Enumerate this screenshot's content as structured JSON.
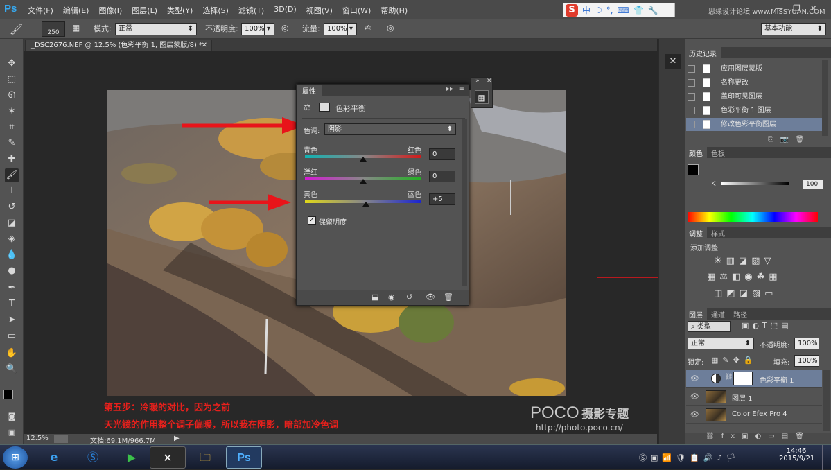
{
  "app": {
    "logo": "Ps"
  },
  "menu": [
    "文件(F)",
    "编辑(E)",
    "图像(I)",
    "图层(L)",
    "类型(Y)",
    "选择(S)",
    "滤镜(T)",
    "3D(D)",
    "视图(V)",
    "窗口(W)",
    "帮助(H)"
  ],
  "ime": {
    "label": "中"
  },
  "watermark": "思缘设计论坛 www.MISSYUAN.COM",
  "options": {
    "brush_size": "250",
    "mode_label": "模式:",
    "mode_value": "正常",
    "opacity_label": "不透明度:",
    "opacity_value": "100%",
    "flow_label": "流量:",
    "flow_value": "100%",
    "workspace": "基本功能"
  },
  "document": {
    "tab_title": "_DSC2676.NEF @ 12.5% (色彩平衡 1, 图层蒙版/8) *",
    "zoom": "12.5%",
    "doc_size": "文档:69.1M/966.7M"
  },
  "properties": {
    "tab": "属性",
    "title": "色彩平衡",
    "tone_label": "色调:",
    "tone_value": "阴影",
    "sliders": [
      {
        "left": "青色",
        "right": "红色",
        "value": "0",
        "position": 0.5
      },
      {
        "left": "洋红",
        "right": "绿色",
        "value": "0",
        "position": 0.5
      },
      {
        "left": "黄色",
        "right": "蓝色",
        "value": "+5",
        "position": 0.525
      }
    ],
    "preserve_label": "保留明度",
    "preserve_checked": true
  },
  "history": {
    "tab": "历史记录",
    "items": [
      "应用图层蒙版",
      "名称更改",
      "盖印可见图层",
      "色彩平衡 1 图层",
      "修改色彩平衡图层"
    ]
  },
  "color": {
    "tabs": [
      "颜色",
      "色板"
    ],
    "channel": "K",
    "value": "100"
  },
  "adjustments": {
    "tabs": [
      "调整",
      "样式"
    ],
    "title": "添加调整"
  },
  "layers": {
    "tabs": [
      "图层",
      "通道",
      "路径"
    ],
    "filter": "类型",
    "blend": "正常",
    "opacity_label": "不透明度:",
    "opacity_value": "100%",
    "lock_label": "锁定:",
    "fill_label": "填充:",
    "fill_value": "100%",
    "rows": [
      {
        "name": "色彩平衡 1",
        "selected": true
      },
      {
        "name": "图层 1",
        "selected": false
      },
      {
        "name": "Color Efex Pro 4",
        "selected": false
      }
    ]
  },
  "notes": {
    "line1": "第五步：冷暖的对比，因为之前",
    "line2": "天光镜的作用整个调子偏暖，所以我在阴影，暗部加冷色调"
  },
  "poco": {
    "brand": "POCO",
    "tagline": "摄影专题",
    "url": "http://photo.poco.cn/"
  },
  "taskbar": {
    "time": "14:46",
    "date": "2015/9/21"
  }
}
